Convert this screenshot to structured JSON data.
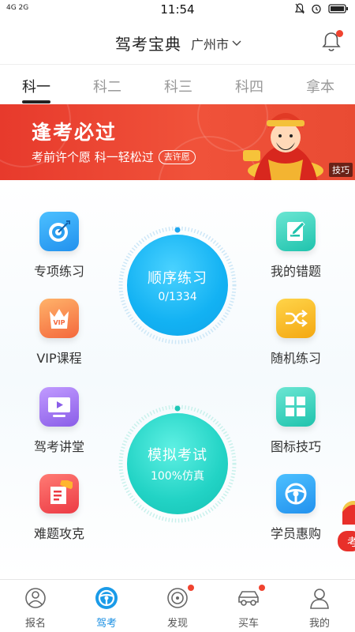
{
  "status_bar": {
    "signal": "4G 2G",
    "time": "11:54"
  },
  "header": {
    "title": "驾考宝典",
    "city": "广州市"
  },
  "tabs": [
    {
      "label": "科一",
      "active": true
    },
    {
      "label": "科二",
      "active": false
    },
    {
      "label": "科三",
      "active": false
    },
    {
      "label": "科四",
      "active": false
    },
    {
      "label": "拿本",
      "active": false
    }
  ],
  "banner": {
    "headline": "逢考必过",
    "subline": "考前许个愿 科一轻松过",
    "cta": "去许愿",
    "tag": "技巧"
  },
  "features_left": [
    {
      "label": "专项练习",
      "icon": "target-icon",
      "color": "#2b9ff0"
    },
    {
      "label": "VIP课程",
      "icon": "vip-crown-icon",
      "color": "#f4683c"
    },
    {
      "label": "驾考讲堂",
      "icon": "video-screen-icon",
      "color": "#9b6cf0"
    },
    {
      "label": "难题攻克",
      "icon": "hard-question-icon",
      "color": "#f0444a"
    }
  ],
  "features_right": [
    {
      "label": "我的错题",
      "icon": "edit-note-icon",
      "color": "#2dcfb8"
    },
    {
      "label": "随机练习",
      "icon": "shuffle-icon",
      "color": "#f5b41c"
    },
    {
      "label": "图标技巧",
      "icon": "grid-icon",
      "color": "#2dcfb8"
    },
    {
      "label": "学员惠购",
      "icon": "steering-wheel-icon",
      "color": "#2b9ff0"
    }
  ],
  "practice": {
    "title": "顺序练习",
    "progress": "0/1334"
  },
  "exam": {
    "title": "模拟考试",
    "subtitle": "100%仿真"
  },
  "float_ad": {
    "label": "考"
  },
  "bottom_nav": [
    {
      "label": "报名",
      "icon": "signup-icon",
      "active": false,
      "badge": false
    },
    {
      "label": "驾考",
      "icon": "steering-wheel-icon",
      "active": true,
      "badge": false
    },
    {
      "label": "发现",
      "icon": "discover-icon",
      "active": false,
      "badge": true
    },
    {
      "label": "买车",
      "icon": "car-icon",
      "active": false,
      "badge": true
    },
    {
      "label": "我的",
      "icon": "profile-icon",
      "active": false,
      "badge": false
    }
  ]
}
